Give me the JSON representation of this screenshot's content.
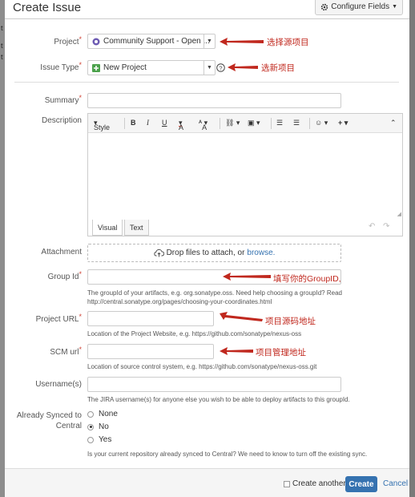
{
  "header": {
    "title": "Create Issue",
    "configure_label": "Configure Fields"
  },
  "project": {
    "label": "Project",
    "value": "Community Support - Open ..."
  },
  "issue_type": {
    "label": "Issue Type",
    "value": "New Project"
  },
  "summary": {
    "label": "Summary"
  },
  "description": {
    "label": "Description",
    "toolbar": {
      "style": "Style",
      "bold": "B",
      "italic": "I",
      "underline": "U",
      "color": "A",
      "size": "A"
    },
    "tabs": [
      "Visual",
      "Text"
    ]
  },
  "attachment": {
    "label": "Attachment",
    "drop_text": "Drop files to attach, or",
    "browse": "browse."
  },
  "group_id": {
    "label": "Group Id",
    "help": "The groupId of your artifacts, e.g. org.sonatype.oss. Need help choosing a groupId? Read http://central.sonatype.org/pages/choosing-your-coordinates.html"
  },
  "project_url": {
    "label": "Project URL",
    "help": "Location of the Project Website, e.g. https://github.com/sonatype/nexus-oss"
  },
  "scm_url": {
    "label": "SCM url",
    "help": "Location of source control system, e.g. https://github.com/sonatype/nexus-oss.git"
  },
  "usernames": {
    "label": "Username(s)",
    "help": "The JIRA username(s) for anyone else you wish to be able to deploy artifacts to this groupId."
  },
  "synced": {
    "label_line1": "Already Synced to",
    "label_line2": "Central",
    "options": [
      "None",
      "No",
      "Yes"
    ],
    "selected": "No",
    "help": "Is your current repository already synced to Central? We need to know to turn off the existing sync."
  },
  "annotations": {
    "project": "选择源项目",
    "issue_type": "选新项目",
    "group_id": "填写你的GroupID,",
    "project_url": "项目源码地址",
    "scm_url": "项目管理地址"
  },
  "footer": {
    "create_another": "Create another",
    "create": "Create",
    "cancel": "Cancel"
  },
  "colors": {
    "accent": "#3572b0",
    "annotation": "#c0281e",
    "required": "#d04437"
  }
}
